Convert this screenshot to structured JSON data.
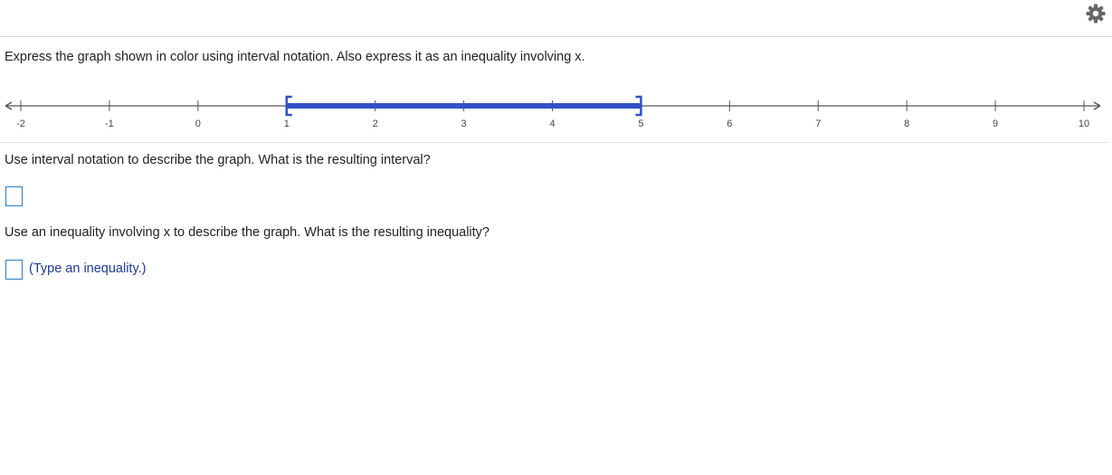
{
  "header": {
    "settings_icon": "gear-icon"
  },
  "prompt": "Express the graph shown in color using interval notation.  Also express it as an inequality involving x.",
  "number_line": {
    "ticks": [
      "-2",
      "-1",
      "0",
      "1",
      "2",
      "3",
      "4",
      "5",
      "6",
      "7",
      "8",
      "9",
      "10"
    ],
    "min": -2,
    "max": 10,
    "interval_start": 1,
    "interval_end": 5,
    "left_endpoint": "closed",
    "right_endpoint": "closed",
    "highlight_color": "#3151c8",
    "axis_color": "#555555"
  },
  "question1": {
    "text": "Use interval notation to describe the graph.  What is the resulting interval?",
    "answer_value": ""
  },
  "question2": {
    "text": "Use an inequality involving x to describe the graph.  What is the resulting inequality?",
    "answer_value": "",
    "hint": "(Type an inequality.)"
  },
  "colors": {
    "input_border": "#2e7dbd",
    "hint_text": "#1d3a8f"
  }
}
